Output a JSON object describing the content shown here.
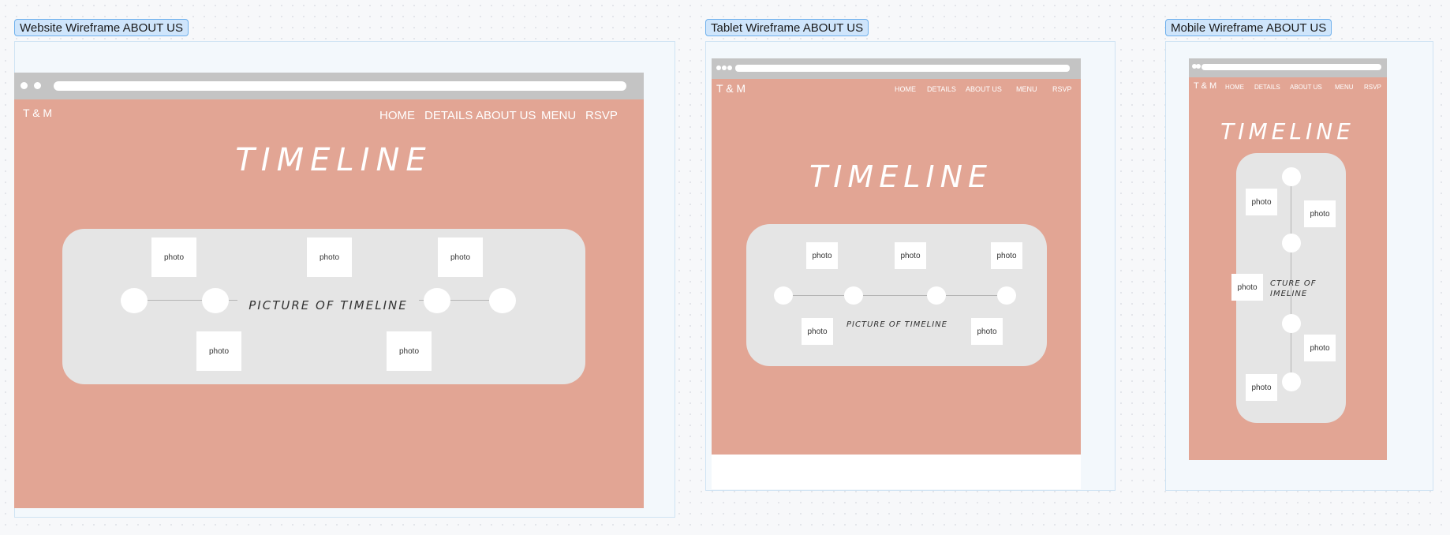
{
  "frames": {
    "website": {
      "label": "Website Wireframe ABOUT US"
    },
    "tablet": {
      "label": "Tablet Wireframe ABOUT US"
    },
    "mobile": {
      "label": "Mobile Wireframe ABOUT US"
    }
  },
  "site": {
    "brand": "T & M",
    "nav": [
      "HOME",
      "DETAILS",
      "ABOUT US",
      "MENU",
      "RSVP"
    ],
    "headline": "TIMELINE",
    "caption": "PICTURE OF TIMELINE",
    "mobile_caption_lines": [
      "CTURE OF",
      "IMELINE"
    ],
    "photo_label": "photo"
  },
  "colors": {
    "page_background": "#e2a594",
    "panel": "#e5e5e5",
    "browser_chrome": "#c4c4c4",
    "label_fill": "#cfe5fb",
    "label_border": "#6fb0ec"
  }
}
